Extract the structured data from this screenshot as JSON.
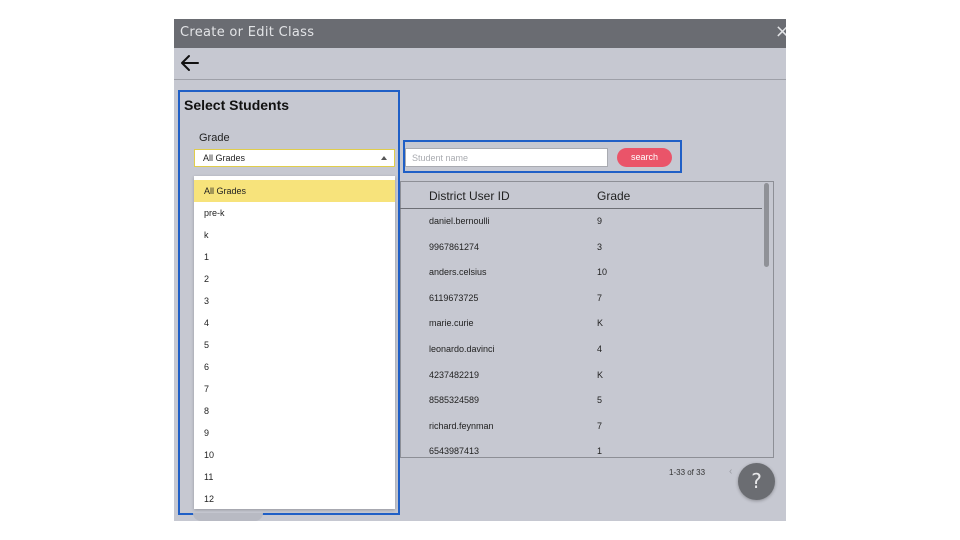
{
  "window": {
    "title": "Create or Edit Class",
    "close_glyph": "×"
  },
  "panel": {
    "title": "Select Students",
    "grade_label": "Grade",
    "grade_value": "All Grades",
    "grade_options": [
      "All Grades",
      "pre-k",
      "k",
      "1",
      "2",
      "3",
      "4",
      "5",
      "6",
      "7",
      "8",
      "9",
      "10",
      "11",
      "12"
    ]
  },
  "search": {
    "placeholder": "Student name",
    "button_label": "search"
  },
  "table": {
    "columns": [
      "District User ID",
      "Grade"
    ],
    "rows": [
      [
        "daniel.bernoulli",
        "9"
      ],
      [
        "9967861274",
        "3"
      ],
      [
        "anders.celsius",
        "10"
      ],
      [
        "6119673725",
        "7"
      ],
      [
        "marie.curie",
        "K"
      ],
      [
        "leonardo.davinci",
        "4"
      ],
      [
        "4237482219",
        "K"
      ],
      [
        "8585324589",
        "5"
      ],
      [
        "richard.feynman",
        "7"
      ],
      [
        "6543987413",
        "1"
      ]
    ]
  },
  "pager": {
    "text": "1-33 of 33",
    "prev_glyph": "‹"
  },
  "help": {
    "label": "?"
  },
  "icons": {
    "back": "arrow-left-icon",
    "close": "close-icon",
    "caret": "caret-up-icon",
    "prev": "chevron-left-icon"
  },
  "colors": {
    "highlight_border": "#1f5fc6",
    "search_button": "#ea5469",
    "selected_option": "#f7e37b",
    "titlebar": "#6a6c72",
    "modal_bg": "#c6c8d1"
  }
}
